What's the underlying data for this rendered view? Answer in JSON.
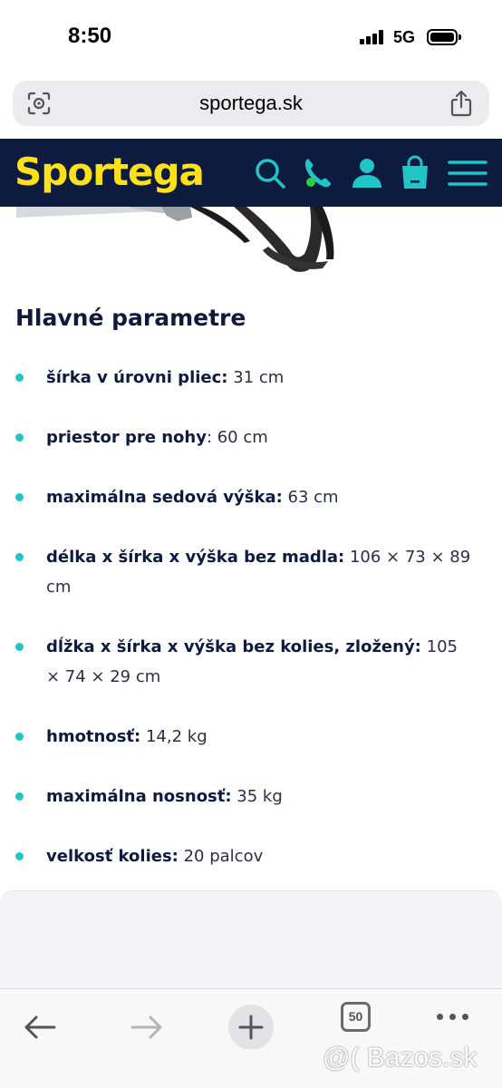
{
  "status": {
    "time": "8:50",
    "network": "5G"
  },
  "browser": {
    "url": "sportega.sk",
    "tabs_count": "50"
  },
  "site": {
    "logo": "Sportega"
  },
  "section": {
    "title": "Hlavné parametre"
  },
  "params": [
    {
      "label": "šírka v úrovni pliec:",
      "value": " 31 cm"
    },
    {
      "label": "priestor pre nohy",
      "value": ": 60 cm"
    },
    {
      "label": "maximálna sedová výška:",
      "value": " 63 cm"
    },
    {
      "label": "délka x šírka x výška bez madla:",
      "value": " 106 × 73 × 89 cm"
    },
    {
      "label": "dĺžka x šírka x výška bez kolies, zložený:",
      "value": " 105 × 74 × 29 cm"
    },
    {
      "label": "hmotnosť:",
      "value": " 14,2 kg"
    },
    {
      "label": "maximálna nosnosť:",
      "value": " 35 kg"
    },
    {
      "label": "velkosť kolies:",
      "value": " 20 palcov"
    }
  ],
  "watermark": "@( Bazos.sk",
  "colors": {
    "header_bg": "#0d1b3e",
    "logo": "#ffe119",
    "accent": "#21c4c7",
    "call_dot": "#2ecc40"
  }
}
